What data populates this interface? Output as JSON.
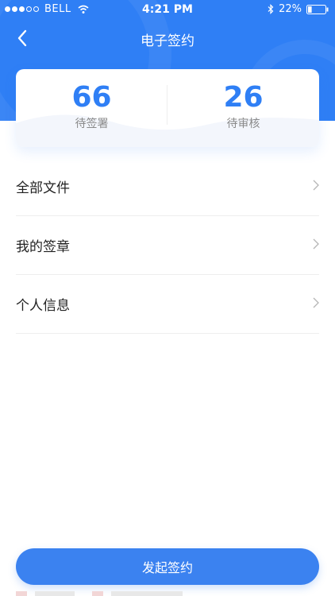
{
  "status_bar": {
    "carrier": "BELL",
    "time": "4:21 PM",
    "battery_percent": "22%",
    "battery_level": 0.22,
    "signal_bars_filled": 3,
    "signal_bars_total": 5
  },
  "nav": {
    "title": "电子签约",
    "back_icon": "chevron-left-icon"
  },
  "stats": [
    {
      "value": "66",
      "label": "待签署"
    },
    {
      "value": "26",
      "label": "待审核"
    }
  ],
  "menu": [
    {
      "label": "全部文件",
      "icon": "chevron-right-icon"
    },
    {
      "label": "我的签章",
      "icon": "chevron-right-icon"
    },
    {
      "label": "个人信息",
      "icon": "chevron-right-icon"
    }
  ],
  "primary_action": {
    "label": "发起签约"
  },
  "colors": {
    "brand": "#2f7ff5",
    "button": "#3b82f0",
    "text": "#222222",
    "muted": "#8a8a8a",
    "divider": "#eeeeee"
  }
}
